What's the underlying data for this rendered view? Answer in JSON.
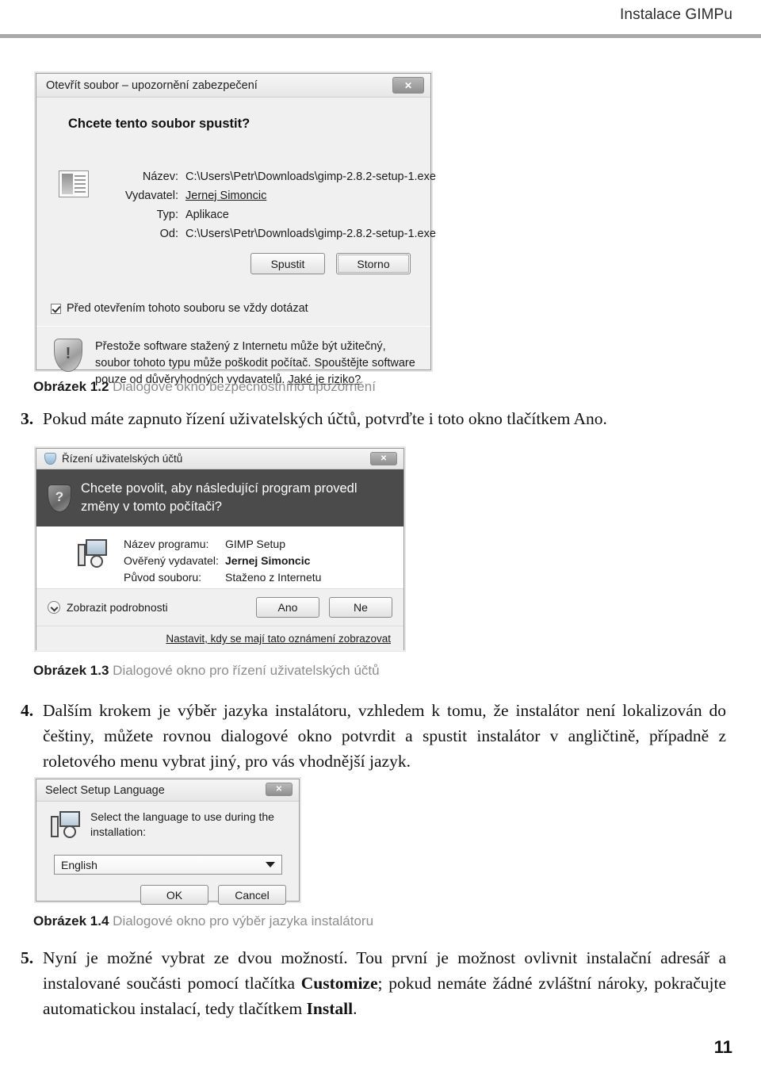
{
  "header": {
    "title": "Instalace GIMPu"
  },
  "page_number": "11",
  "dialog_security": {
    "title": "Otevřít soubor – upozornění zabezpečení",
    "close_label": "✕",
    "question": "Chcete tento soubor spustit?",
    "fields": [
      {
        "label": "Název:",
        "value": "C:\\Users\\Petr\\Downloads\\gimp-2.8.2-setup-1.exe"
      },
      {
        "label": "Vydavatel:",
        "value": "Jernej Simoncic"
      },
      {
        "label": "Typ:",
        "value": "Aplikace"
      },
      {
        "label": "Od:",
        "value": "C:\\Users\\Petr\\Downloads\\gimp-2.8.2-setup-1.exe"
      }
    ],
    "run_button": "Spustit",
    "cancel_button": "Storno",
    "checkbox_label": "Před otevřením tohoto souboru se vždy dotázat",
    "warning_text": "Přestože software stažený z Internetu může být užitečný, soubor tohoto typu může poškodit počítač. Spouštějte software pouze od důvěryhodných vydavatelů.",
    "warning_link": "Jaké je riziko?",
    "shield_glyph": "!"
  },
  "caption_1_2": {
    "number": "Obrázek 1.2",
    "text": " Dialogové okno bezpečnostního upozornění"
  },
  "item_3": {
    "number": "3.",
    "text": "Pokud máte zapnuto řízení uživatelských účtů, potvrďte i toto okno tlačítkem Ano."
  },
  "dialog_uac": {
    "title": "Řízení uživatelských účtů",
    "close_label": "✕",
    "banner_text": "Chcete povolit, aby následující program provedl změny v tomto počítači?",
    "banner_glyph": "?",
    "fields": [
      {
        "label": "Název programu:",
        "value": "GIMP Setup",
        "bold": false
      },
      {
        "label": "Ověřený vydavatel:",
        "value": "Jernej Simoncic",
        "bold": true
      },
      {
        "label": "Původ souboru:",
        "value": "Staženo z Internetu",
        "bold": false
      }
    ],
    "details_label": "Zobrazit podrobnosti",
    "yes_button": "Ano",
    "no_button": "Ne",
    "settings_link": "Nastavit, kdy se mají tato oznámení zobrazovat"
  },
  "caption_1_3": {
    "number": "Obrázek 1.3",
    "text": " Dialogové okno pro řízení uživatelských účtů"
  },
  "item_4": {
    "number": "4.",
    "text": "Dalším krokem je výběr jazyka instalátoru, vzhledem k tomu, že instalátor není lokalizován do češtiny, můžete rovnou dialogové okno potvrdit a spustit instalátor v angličtině, případně z roletového menu vybrat jiný, pro vás vhodnější jazyk."
  },
  "dialog_language": {
    "title": "Select Setup Language",
    "close_label": "✕",
    "prompt": "Select the language to use during the installation:",
    "selected_language": "English",
    "ok_button": "OK",
    "cancel_button": "Cancel"
  },
  "caption_1_4": {
    "number": "Obrázek 1.4",
    "text": " Dialogové okno pro výběr jazyka instalátoru"
  },
  "item_5": {
    "number": "5.",
    "text_part_1": "Nyní je možné vybrat ze dvou možností. Tou první je možnost ovlivnit instalační adresář a instalované součásti pomocí tlačítka ",
    "bold_1": "Customize",
    "text_part_2": "; pokud nemáte žádné zvláštní nároky, pokračujte automatickou instalací, tedy tlačítkem ",
    "bold_2": "Install",
    "text_part_3": "."
  }
}
